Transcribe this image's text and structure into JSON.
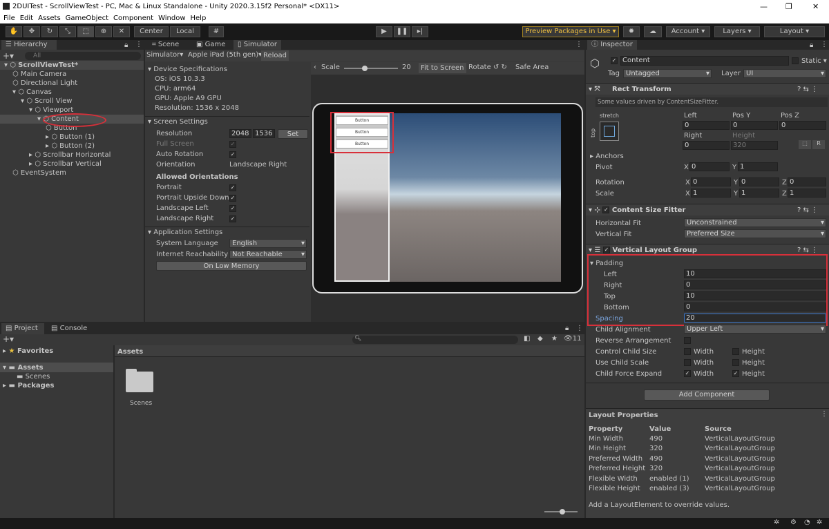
{
  "titlebar": {
    "title": "2DUITest - ScrollViewTest - PC, Mac & Linux Standalone - Unity 2020.3.15f2 Personal* <DX11>",
    "min": "—",
    "max": "❐",
    "close": "✕"
  },
  "menu": [
    "File",
    "Edit",
    "Assets",
    "GameObject",
    "Component",
    "Window",
    "Help"
  ],
  "toolbar": {
    "center": "Center",
    "local": "Local",
    "preview": "Preview Packages in Use",
    "account": "Account",
    "layers": "Layers",
    "layout": "Layout"
  },
  "hierarchy": {
    "tab": "Hierarchy",
    "search_placeholder": "All",
    "items": [
      {
        "label": "ScrollViewTest*",
        "indent": 0
      },
      {
        "label": "Main Camera",
        "indent": 1
      },
      {
        "label": "Directional Light",
        "indent": 1
      },
      {
        "label": "Canvas",
        "indent": 1
      },
      {
        "label": "Scroll View",
        "indent": 2
      },
      {
        "label": "Viewport",
        "indent": 3
      },
      {
        "label": "Content",
        "indent": 4
      },
      {
        "label": "Button",
        "indent": 5
      },
      {
        "label": "Button (1)",
        "indent": 5
      },
      {
        "label": "Button (2)",
        "indent": 5
      },
      {
        "label": "Scrollbar Horizontal",
        "indent": 3
      },
      {
        "label": "Scrollbar Vertical",
        "indent": 3
      },
      {
        "label": "EventSystem",
        "indent": 1
      }
    ]
  },
  "tabs": {
    "scene": "Scene",
    "game": "Game",
    "simulator": "Simulator"
  },
  "simbar": {
    "mode": "Simulator",
    "device": "Apple iPad (5th gen)",
    "reload": "Reload",
    "scale_label": "Scale",
    "scale_value": "20",
    "scale_fraction": 0.38,
    "fit": "Fit to Screen",
    "rotate": "Rotate",
    "safe": "Safe Area"
  },
  "device": {
    "header": "Device Specifications",
    "os": "OS: iOS 10.3.3",
    "cpu": "CPU: arm64",
    "gpu": "GPU: Apple A9 GPU",
    "res": "Resolution: 1536 x 2048"
  },
  "screen": {
    "header": "Screen Settings",
    "resolution": "Resolution",
    "w": "2048",
    "h": "1536",
    "set": "Set",
    "full": "Full Screen",
    "auto": "Auto Rotation",
    "orient": "Orientation",
    "orient_val": "Landscape Right",
    "allowed": "Allowed Orientations",
    "portrait": "Portrait",
    "portrait_ud": "Portrait Upside Down",
    "land_l": "Landscape Left",
    "land_r": "Landscape Right"
  },
  "app": {
    "header": "Application Settings",
    "lang": "System Language",
    "lang_val": "English",
    "net": "Internet Reachability",
    "net_val": "Not Reachable",
    "lowmem": "On Low Memory"
  },
  "game_buttons": [
    "Button",
    "Button",
    "Button"
  ],
  "project": {
    "tab": "Project",
    "console": "Console",
    "favorites": "Favorites",
    "assets": "Assets",
    "scenes": "Scenes",
    "packages": "Packages",
    "crumb": "Assets",
    "folder": "Scenes",
    "count": "11"
  },
  "inspector": {
    "tab": "Inspector",
    "name": "Content",
    "static": "Static",
    "tag_label": "Tag",
    "tag": "Untagged",
    "layer_label": "Layer",
    "layer": "UI",
    "rect": {
      "header": "Rect Transform",
      "note": "Some values driven by ContentSizeFitter.",
      "stretch": "stretch",
      "top": "top",
      "left": "Left",
      "posy": "Pos Y",
      "posz": "Pos Z",
      "left_v": "0",
      "posy_v": "0",
      "posz_v": "0",
      "right": "Right",
      "height": "Height",
      "right_v": "0",
      "height_v": "320",
      "anchors": "Anchors",
      "pivot": "Pivot",
      "pivot_x": "0",
      "pivot_y": "1",
      "rotation": "Rotation",
      "rot_x": "0",
      "rot_y": "0",
      "rot_z": "0",
      "scale": "Scale",
      "sc_x": "1",
      "sc_y": "1",
      "sc_z": "1"
    },
    "csf": {
      "header": "Content Size Fitter",
      "hfit": "Horizontal Fit",
      "hfit_v": "Unconstrained",
      "vfit": "Vertical Fit",
      "vfit_v": "Preferred Size"
    },
    "vlg": {
      "header": "Vertical Layout Group",
      "padding": "Padding",
      "left": "Left",
      "left_v": "10",
      "right": "Right",
      "right_v": "0",
      "top": "Top",
      "top_v": "10",
      "bottom": "Bottom",
      "bottom_v": "0",
      "spacing": "Spacing",
      "spacing_v": "20",
      "align": "Child Alignment",
      "align_v": "Upper Left",
      "reverse": "Reverse Arrangement",
      "control": "Control Child Size",
      "usescale": "Use Child Scale",
      "force": "Child Force Expand",
      "width": "Width",
      "height": "Height"
    },
    "add": "Add Component",
    "layout": {
      "header": "Layout Properties",
      "cols": [
        "Property",
        "Value",
        "Source"
      ],
      "rows": [
        [
          "Min Width",
          "490",
          "VerticalLayoutGroup"
        ],
        [
          "Min Height",
          "320",
          "VerticalLayoutGroup"
        ],
        [
          "Preferred Width",
          "490",
          "VerticalLayoutGroup"
        ],
        [
          "Preferred Height",
          "320",
          "VerticalLayoutGroup"
        ],
        [
          "Flexible Width",
          "enabled (1)",
          "VerticalLayoutGroup"
        ],
        [
          "Flexible Height",
          "enabled (3)",
          "VerticalLayoutGroup"
        ]
      ],
      "note": "Add a LayoutElement to override values."
    }
  }
}
